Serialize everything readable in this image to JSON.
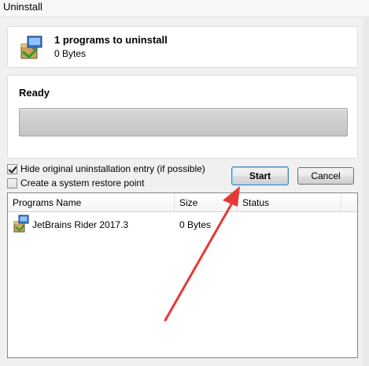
{
  "window": {
    "title": "Uninstall"
  },
  "summary": {
    "count_text": "1 programs to uninstall",
    "size_text": "0 Bytes",
    "icon": "installer-package-icon"
  },
  "status": {
    "label": "Ready",
    "progress": 0
  },
  "options": {
    "hide_entry": {
      "label": "Hide original uninstallation entry (if possible)",
      "checked": true
    },
    "restore_point": {
      "label": "Create a system restore point",
      "checked": false
    }
  },
  "buttons": {
    "start_label": "Start",
    "cancel_label": "Cancel"
  },
  "list": {
    "columns": [
      "Programs Name",
      "Size",
      "Status"
    ],
    "rows": [
      {
        "name": "JetBrains Rider 2017.3",
        "size": "0 Bytes",
        "status": ""
      }
    ]
  },
  "annotation": {
    "type": "arrow",
    "color": "#e53935",
    "points_to": "start-button"
  }
}
